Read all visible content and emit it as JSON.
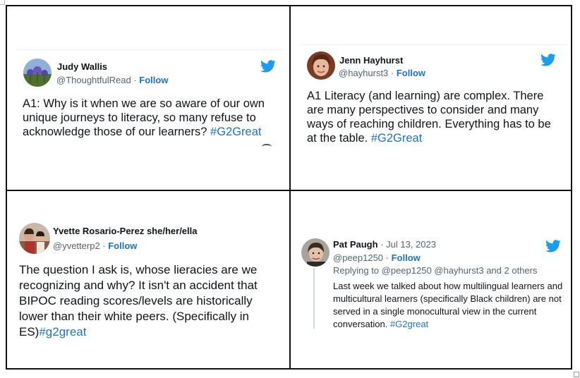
{
  "tweets": [
    {
      "author": "Judy Wallis",
      "handle": "@ThoughtfulRead",
      "separator": " · ",
      "follow": "Follow",
      "text": "A1: Why is it when we are so aware of our own unique journeys to literacy, so many refuse to acknowledge those of our learners?",
      "hashtag": "#G2Great"
    },
    {
      "author": "Jenn Hayhurst",
      "handle": "@hayhurst3",
      "separator": " · ",
      "follow": "Follow",
      "text": "A1 Literacy (and learning) are complex. There are many perspectives to consider and many ways of reaching children. Everything has to be at the table. ",
      "hashtag": "#G2Great"
    },
    {
      "author": "Yvette Rosario-Perez she/her/ella",
      "handle": "@yvetterp2",
      "separator": " · ",
      "follow": "Follow",
      "text": "The question I ask is, whose lieracies are we recognizing and why? It isn't an accident that BIPOC reading scores/levels are historically lower than their white peers. (Specifically in ES)",
      "hashtag": "#g2great"
    },
    {
      "author": "Pat Paugh",
      "date": " · Jul 13, 2023",
      "handle": "@peep1250",
      "separator": " · ",
      "follow": "Follow",
      "replying": "Replying to @peep1250 @hayhurst3 and 2 others",
      "text": "Last week we talked about how multilingual learners and multicultural learners (specifically Black children) are not served in a single monocultural view in the current conversation.",
      "hashtag": "#G2great"
    }
  ],
  "colors": {
    "link": "#1d72c2",
    "twitter": "#1d9bf0",
    "muted": "#536471"
  },
  "icons": {
    "brand": "twitter-bird-icon"
  }
}
